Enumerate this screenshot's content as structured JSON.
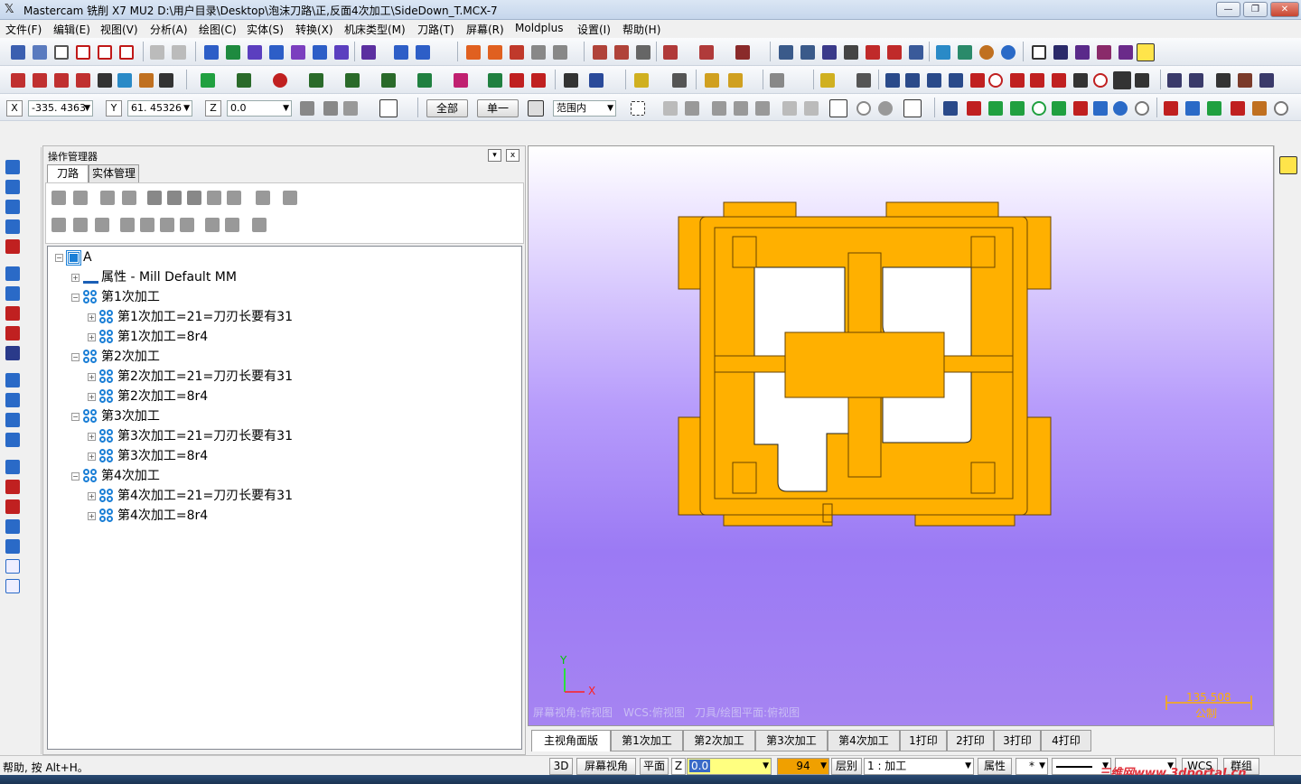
{
  "window": {
    "title": "Mastercam 铣削 X7 MU2  D:\\用户目录\\Desktop\\泡沫刀路\\正,反面4次加工\\SideDown_T.MCX-7",
    "minimize": "—",
    "restore": "❐",
    "close": "✕"
  },
  "menu": [
    "文件(F)",
    "编辑(E)",
    "视图(V)",
    "分析(A)",
    "绘图(C)",
    "实体(S)",
    "转换(X)",
    "机床类型(M)",
    "刀路(T)",
    "屏幕(R)",
    "Moldplus",
    "设置(I)",
    "帮助(H)"
  ],
  "coords": {
    "x_label": "X",
    "x_value": "-335. 4363",
    "y_label": "Y",
    "y_value": "61. 45326",
    "z_label": "Z",
    "z_value": "0.0",
    "all_button": "全部",
    "single_button": "单一",
    "range_value": "范围内"
  },
  "ops_manager": {
    "title": "操作管理器",
    "pin": "▾",
    "close": "x",
    "tabs": [
      "刀路",
      "实体管理"
    ],
    "tree": {
      "root": "A",
      "properties": "属性 - Mill Default MM",
      "groups": [
        {
          "name": "第1次加工",
          "ops": [
            "第1次加工=21=刀刃长要有31",
            "第1次加工=8r4"
          ]
        },
        {
          "name": "第2次加工",
          "ops": [
            "第2次加工=21=刀刃长要有31",
            "第2次加工=8r4"
          ]
        },
        {
          "name": "第3次加工",
          "ops": [
            "第3次加工=21=刀刃长要有31",
            "第3次加工=8r4"
          ]
        },
        {
          "name": "第4次加工",
          "ops": [
            "第4次加工=21=刀刃长要有31",
            "第4次加工=8r4"
          ]
        }
      ]
    }
  },
  "viewport": {
    "axis_y": "Y",
    "axis_x": "X",
    "screen_view": "屏幕视角:俯视图",
    "wcs_view": "WCS:俯视图",
    "tool_plane": "刀具/绘图平面:俯视图",
    "scale_value": "135.508",
    "scale_unit": "公制",
    "part_color": "#ffb000"
  },
  "viewport_tabs": [
    "主视角面版",
    "第1次加工",
    "第2次加工",
    "第3次加工",
    "第4次加工",
    "1打印",
    "2打印",
    "3打印",
    "4打印"
  ],
  "status": {
    "help": "帮助, 按 Alt+H。",
    "btn_3d": "3D",
    "screen_view": "屏幕视角",
    "plane": "平面",
    "z_label": "Z",
    "z_value": "0.0",
    "color_value": "94",
    "level_label": "层别",
    "level_value": "1 : 加工",
    "attr_label": "属性",
    "point_style": "*",
    "wcs": "WCS",
    "group": "群组"
  },
  "watermark": "三维网www.3dportal.cn"
}
